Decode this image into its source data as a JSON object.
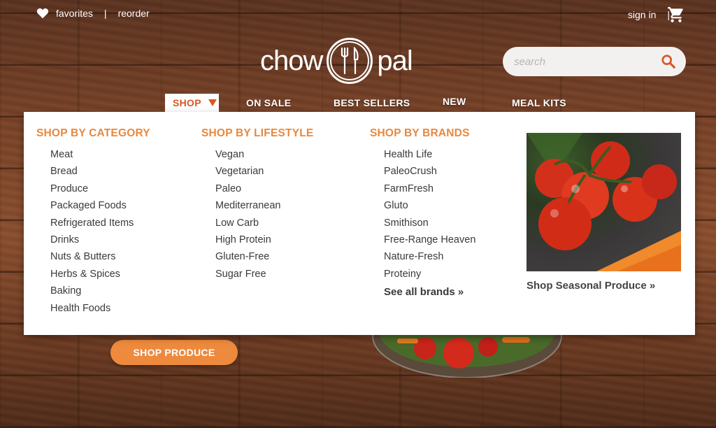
{
  "topbar": {
    "favorites": "favorites",
    "reorder": "reorder",
    "separator": "|",
    "sign_in": "sign in",
    "cart_icon": "cart-icon",
    "heart_icon": "heart-icon"
  },
  "logo": {
    "left": "chow",
    "right": "pal",
    "icon": "fork-knife-icon"
  },
  "search": {
    "placeholder": "search",
    "icon": "search-icon"
  },
  "nav": {
    "items": [
      "SHOP",
      "ON SALE",
      "BEST SELLERS",
      "NEW",
      "MEAL KITS"
    ]
  },
  "dropdown": {
    "columns": [
      {
        "heading": "SHOP BY CATEGORY",
        "items": [
          "Meat",
          "Bread",
          "Produce",
          "Packaged Foods",
          "Refrigerated Items",
          "Drinks",
          "Nuts & Butters",
          "Herbs & Spices",
          "Baking",
          "Health Foods"
        ]
      },
      {
        "heading": "SHOP BY LIFESTYLE",
        "items": [
          "Vegan",
          "Vegetarian",
          "Paleo",
          "Mediterranean",
          "Low Carb",
          "High Protein",
          "Gluten-Free",
          "Sugar Free"
        ]
      },
      {
        "heading": "SHOP BY BRANDS",
        "items": [
          "Health Life",
          "PaleoCrush",
          "FarmFresh",
          "Gluto",
          "Smithison",
          "Free-Range Heaven",
          "Nature-Fresh",
          "Proteiny"
        ],
        "see_all": "See all brands »"
      }
    ],
    "promo_caption": "Shop Seasonal Produce »"
  },
  "hero": {
    "button": "SHOP PRODUCE"
  },
  "colors": {
    "accent": "#e8883d",
    "nav_active": "#d9541e",
    "button": "#ee8a3d"
  }
}
